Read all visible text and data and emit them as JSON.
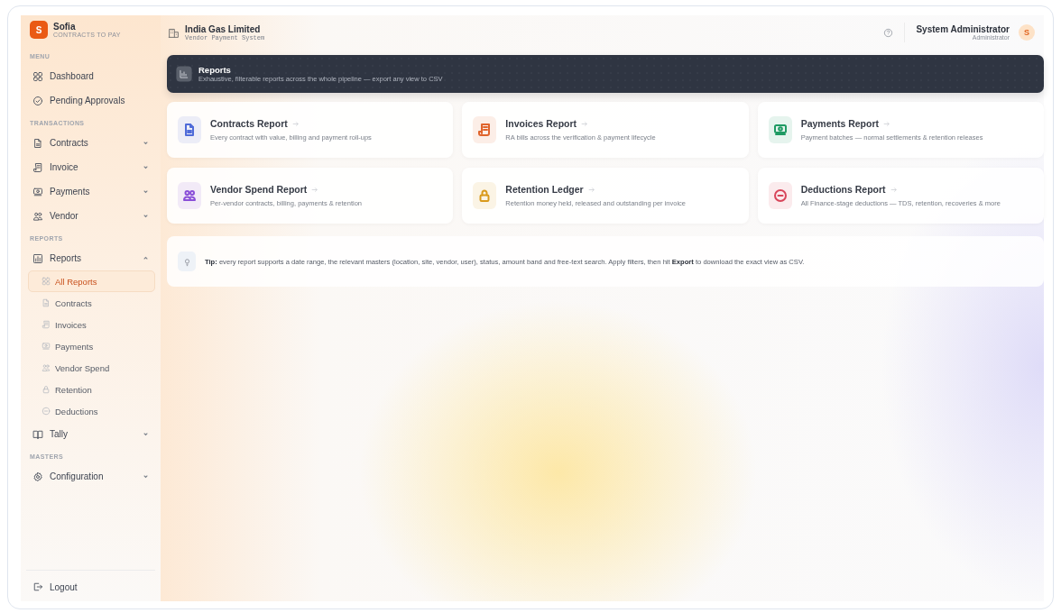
{
  "sidebar": {
    "brand": {
      "initial": "S",
      "name": "Sofia",
      "tagline": "CONTRACTS TO PAY"
    },
    "sections": [
      {
        "heading": "MENU",
        "items": [
          {
            "label": "Dashboard",
            "kind": "link"
          },
          {
            "label": "Pending Approvals",
            "kind": "link"
          }
        ]
      },
      {
        "heading": "TRANSACTIONS",
        "items": [
          {
            "label": "Contracts",
            "kind": "group",
            "expanded": false
          },
          {
            "label": "Invoice",
            "kind": "group",
            "expanded": false
          },
          {
            "label": "Payments",
            "kind": "group",
            "expanded": false
          },
          {
            "label": "Vendor",
            "kind": "group",
            "expanded": false
          }
        ]
      },
      {
        "heading": "REPORTS",
        "items": [
          {
            "label": "Reports",
            "kind": "group",
            "expanded": true,
            "children": [
              {
                "label": "All Reports",
                "selected": true
              },
              {
                "label": "Contracts",
                "selected": false
              },
              {
                "label": "Invoices",
                "selected": false
              },
              {
                "label": "Payments",
                "selected": false
              },
              {
                "label": "Vendor Spend",
                "selected": false
              },
              {
                "label": "Retention",
                "selected": false
              },
              {
                "label": "Deductions",
                "selected": false
              }
            ]
          },
          {
            "label": "Tally",
            "kind": "group",
            "expanded": false
          }
        ]
      },
      {
        "heading": "MASTERS",
        "items": [
          {
            "label": "Configuration",
            "kind": "group",
            "expanded": false
          }
        ]
      }
    ],
    "logout": "Logout"
  },
  "header": {
    "org": "India Gas Limited",
    "subtitle": "Vendor Payment System",
    "user": {
      "name": "System Administrator",
      "role": "Administrator",
      "initial": "S"
    }
  },
  "banner": {
    "title": "Reports",
    "subtitle": "Exhaustive, filterable reports across the whole pipeline — export any view to CSV"
  },
  "cards": [
    {
      "title": "Contracts Report",
      "description": "Every contract with value, billing and payment roll-ups",
      "color": "#4f6bd8"
    },
    {
      "title": "Invoices Report",
      "description": "RA bills across the verification & payment lifecycle",
      "color": "#e0642c"
    },
    {
      "title": "Payments Report",
      "description": "Payment batches — normal settlements & retention releases",
      "color": "#1f9a63"
    },
    {
      "title": "Vendor Spend Report",
      "description": "Per-vendor contracts, billing, payments & retention",
      "color": "#8a4fd8"
    },
    {
      "title": "Retention Ledger",
      "description": "Retention money held, released and outstanding per invoice",
      "color": "#d99a1c"
    },
    {
      "title": "Deductions Report",
      "description": "All Finance-stage deductions — TDS, retention, recoveries & more",
      "color": "#d8455a"
    }
  ],
  "tip": "**Tip:** every report supports a date range, the relevant masters (location, site, vendor, user), status, amount band and free-text search. Apply filters, then hit **Export** to download the exact view as CSV."
}
